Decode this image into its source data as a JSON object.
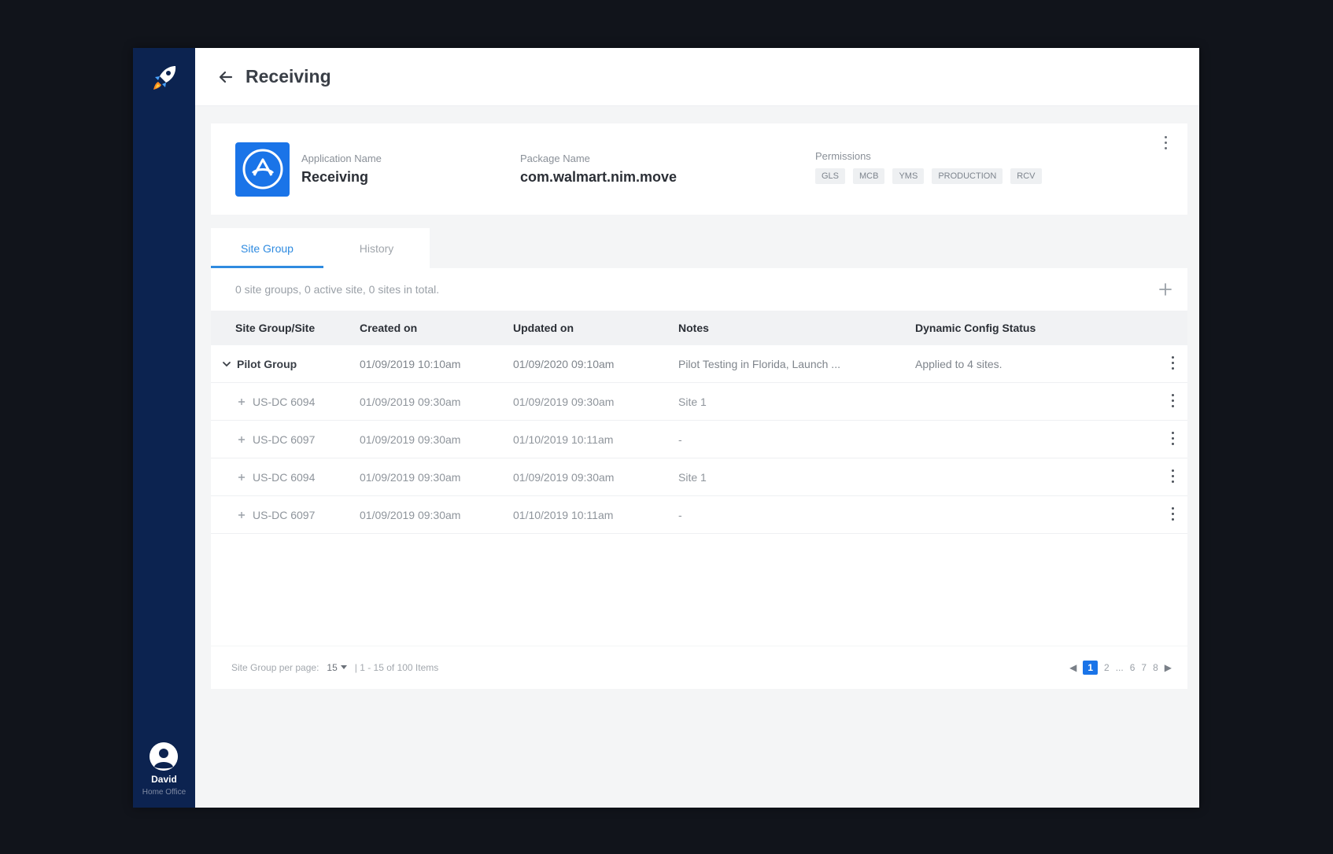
{
  "page": {
    "title": "Receiving"
  },
  "user": {
    "name": "David",
    "org": "Home Office"
  },
  "app": {
    "name_label": "Application Name",
    "name": "Receiving",
    "package_label": "Package Name",
    "package": "com.walmart.nim.move",
    "permissions_label": "Permissions",
    "permissions": [
      "GLS",
      "MCB",
      "YMS",
      "PRODUCTION",
      "RCV"
    ]
  },
  "tabs": [
    {
      "label": "Site Group",
      "active": true
    },
    {
      "label": "History",
      "active": false
    }
  ],
  "summary": "0 site groups, 0 active site, 0 sites in total.",
  "table": {
    "columns": [
      "Site Group/Site",
      "Created on",
      "Updated on",
      "Notes",
      "Dynamic Config Status"
    ],
    "group": {
      "name": "Pilot Group",
      "created": "01/09/2019 10:10am",
      "updated": "01/09/2020 09:10am",
      "notes": "Pilot Testing in Florida, Launch ...",
      "status": "Applied to 4 sites."
    },
    "rows": [
      {
        "site": "US-DC 6094",
        "created": "01/09/2019 09:30am",
        "updated": "01/09/2019 09:30am",
        "notes": "Site 1"
      },
      {
        "site": "US-DC 6097",
        "created": "01/09/2019 09:30am",
        "updated": "01/10/2019 10:11am",
        "notes": "-"
      },
      {
        "site": "US-DC 6094",
        "created": "01/09/2019 09:30am",
        "updated": "01/09/2019 09:30am",
        "notes": "Site 1"
      },
      {
        "site": "US-DC 6097",
        "created": "01/09/2019 09:30am",
        "updated": "01/10/2019 10:11am",
        "notes": "-"
      }
    ]
  },
  "footer": {
    "per_page_label": "Site Group per page:",
    "per_page_value": "15",
    "range_text": "| 1 - 15 of 100 Items",
    "pages": [
      "1",
      "2",
      "...",
      "6",
      "7",
      "8"
    ],
    "active_page": "1"
  },
  "colors": {
    "sidebar": "#0c2350",
    "accent": "#1a74e8",
    "tab_active": "#2f8be0"
  }
}
